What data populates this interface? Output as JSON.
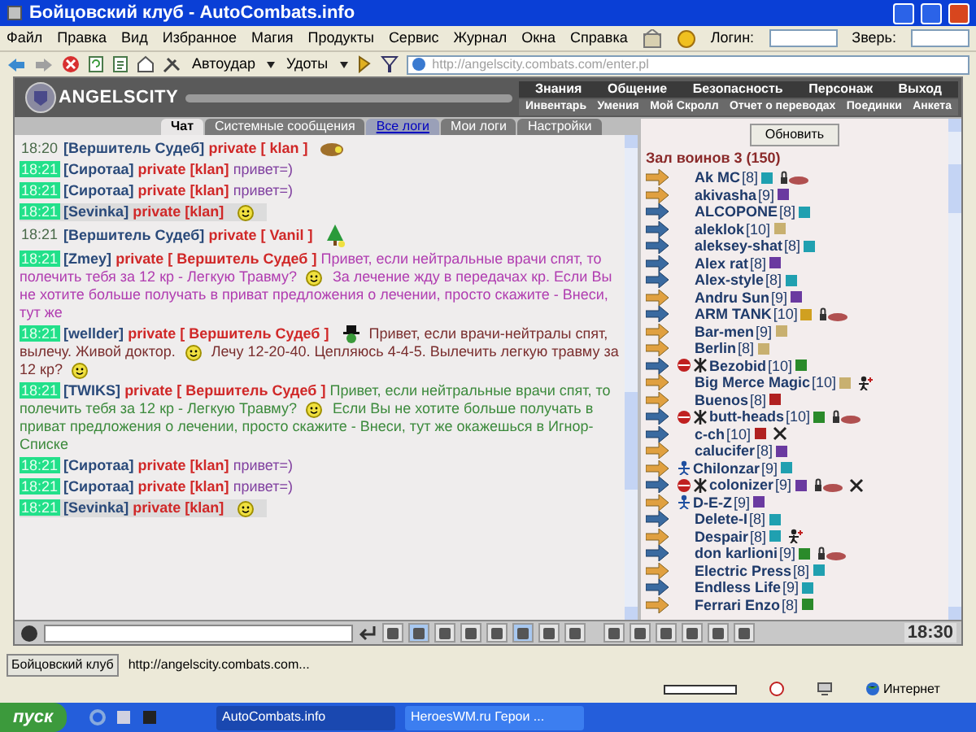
{
  "window": {
    "title": "Бойцовский клуб - AutoCombats.info"
  },
  "menu": [
    "Файл",
    "Правка",
    "Вид",
    "Избранное",
    "Магия",
    "Продукты",
    "Сервис",
    "Журнал",
    "Окна",
    "Справка"
  ],
  "login": {
    "label": "Логин:"
  },
  "pet": {
    "label": "Зверь:"
  },
  "toolbar": {
    "buttons": [
      "Автоудар",
      "Удоты"
    ],
    "address": "http://angelscity.combats.com/enter.pl"
  },
  "game": {
    "logo": "ANGELSCITY",
    "nav_top": [
      "Знания",
      "Общение",
      "Безопасность",
      "Персонаж",
      "Выход"
    ],
    "nav_bottom": [
      "Инвентарь",
      "Умения",
      "Мой Скролл",
      "Отчет о переводах",
      "Поединки",
      "Анкета"
    ]
  },
  "tabs": [
    {
      "label": "Чат",
      "selected": true,
      "kind": "tab"
    },
    {
      "label": "Системные сообщения",
      "selected": false,
      "kind": "tab"
    },
    {
      "label": "Все логи",
      "selected": false,
      "kind": "link"
    },
    {
      "label": "Мои логи",
      "selected": false,
      "kind": "tab"
    },
    {
      "label": "Настройки",
      "selected": false,
      "kind": "tab"
    }
  ],
  "chat": {
    "messages": [
      {
        "time": "18:20",
        "highlighted": false,
        "boxed": false,
        "sender": "[Вершитель Судеб]",
        "target": "private [ klan ]",
        "parts": [
          {
            "kind": "icon"
          }
        ]
      },
      {
        "time": "18:21",
        "highlighted": true,
        "boxed": false,
        "sender": "[Сиротаа]",
        "target": "private [klan]",
        "color": "#8040a0",
        "parts": [
          {
            "kind": "text",
            "text": "привет=)"
          }
        ]
      },
      {
        "time": "18:21",
        "highlighted": true,
        "boxed": false,
        "sender": "[Сиротаа]",
        "target": "private [klan]",
        "color": "#8040a0",
        "parts": [
          {
            "kind": "text",
            "text": "привет=)"
          }
        ]
      },
      {
        "time": "18:21",
        "highlighted": true,
        "boxed": true,
        "sender": "[Sevinka]",
        "target": "private [klan]",
        "parts": [
          {
            "kind": "smiley"
          }
        ]
      },
      {
        "time": "18:21",
        "highlighted": false,
        "boxed": false,
        "sender": "[Вершитель Судеб]",
        "target": "private [ Vanil ]",
        "parts": [
          {
            "kind": "tree"
          }
        ]
      },
      {
        "time": "18:21",
        "highlighted": true,
        "boxed": false,
        "sender": "[Zmey]",
        "target": "private [ Вершитель Судеб ]",
        "color": "#b03cb0",
        "parts": [
          {
            "kind": "text",
            "text": "Привет, если нейтральные врачи спят, то полечить тебя за 12 кр - Легкую Травму?"
          },
          {
            "kind": "smiley"
          },
          {
            "kind": "text",
            "text": "За лечение жду в передачах кр. Если Вы не хотите больше получать в приват предложения о лечении, просто скажите - Внеси, тут же"
          }
        ]
      },
      {
        "time": "18:21",
        "highlighted": true,
        "boxed": false,
        "sender": "[wellder]",
        "target": "private [ Вершитель Судеб ]",
        "color": "#7a2e2e",
        "parts": [
          {
            "kind": "hat"
          },
          {
            "kind": "text",
            "text": "Привет, если врачи-нейтралы спят, вылечу. Живой доктор."
          },
          {
            "kind": "smiley"
          },
          {
            "kind": "text",
            "text": "Лечу 12-20-40. Цепляюсь 4-4-5. Вылечить легкую травму за 12 кр?"
          },
          {
            "kind": "smiley"
          }
        ]
      },
      {
        "time": "18:21",
        "highlighted": true,
        "boxed": false,
        "sender": "[TWIKS]",
        "target": "private [ Вершитель Судеб ]",
        "color": "#3c8a3c",
        "parts": [
          {
            "kind": "text",
            "text": "Привет, если нейтральные врачи спят, то полечить тебя за 12 кр - Легкую Травму?"
          },
          {
            "kind": "smiley"
          },
          {
            "kind": "text",
            "text": "Если Вы не хотите больше получать в приват предложения о лечении, просто скажите - Внеси, тут же окажешься в Игнор-Списке"
          }
        ]
      },
      {
        "time": "18:21",
        "highlighted": true,
        "boxed": false,
        "sender": "[Сиротаа]",
        "target": "private [klan]",
        "color": "#8040a0",
        "parts": [
          {
            "kind": "text",
            "text": "привет=)"
          }
        ]
      },
      {
        "time": "18:21",
        "highlighted": true,
        "boxed": false,
        "sender": "[Сиротаа]",
        "target": "private [klan]",
        "color": "#8040a0",
        "parts": [
          {
            "kind": "text",
            "text": "привет=)"
          }
        ]
      },
      {
        "time": "18:21",
        "highlighted": true,
        "boxed": true,
        "sender": "[Sevinka]",
        "target": "private [klan]",
        "parts": [
          {
            "kind": "smiley"
          }
        ]
      }
    ]
  },
  "room": {
    "refresh_button": "Обновить",
    "title": "Зал воинов 3 (150)",
    "users": [
      {
        "name": "Ak MC",
        "level": "[8]",
        "kind": "light",
        "color": "#20a0b0",
        "locked": true
      },
      {
        "name": "akivasha",
        "level": "[9]",
        "kind": "light",
        "color": "#6a3aa0"
      },
      {
        "name": "ALCOPONE",
        "level": "[8]",
        "kind": "dark",
        "color": "#20a0b0"
      },
      {
        "name": "aleklok",
        "level": "[10]",
        "kind": "dark",
        "color": "#c8b070"
      },
      {
        "name": "aleksey-shat",
        "level": "[8]",
        "kind": "dark",
        "color": "#20a0b0"
      },
      {
        "name": "Alex rat",
        "level": "[8]",
        "kind": "dark",
        "color": "#6a3aa0"
      },
      {
        "name": "Alex-style",
        "level": "[8]",
        "kind": "dark",
        "color": "#20a0b0"
      },
      {
        "name": "Andru Sun",
        "level": "[9]",
        "kind": "light",
        "color": "#6a3aa0"
      },
      {
        "name": "ARM TANK",
        "level": "[10]",
        "kind": "dark",
        "color": "#d0a020",
        "locked": true
      },
      {
        "name": "Bar-men",
        "level": "[9]",
        "kind": "light",
        "color": "#c8b070"
      },
      {
        "name": "Berlin",
        "level": "[8]",
        "kind": "light",
        "color": "#c8b070"
      },
      {
        "name": "Bezobid",
        "level": "[10]",
        "kind": "dark",
        "color": "#2a8a2a",
        "clan": true
      },
      {
        "name": "Big Merce Magic",
        "level": "[10]",
        "kind": "light",
        "color": "#c8b070",
        "healer": true
      },
      {
        "name": "Buenos",
        "level": "[8]",
        "kind": "light",
        "color": "#b02020"
      },
      {
        "name": "butt-heads",
        "level": "[10]",
        "kind": "dark",
        "color": "#2a8a2a",
        "clan": true,
        "locked": true
      },
      {
        "name": "c-ch",
        "level": "[10]",
        "kind": "dark",
        "color": "#b02020",
        "crossed": true
      },
      {
        "name": "calucifer",
        "level": "[8]",
        "kind": "light",
        "color": "#6a3aa0"
      },
      {
        "name": "Chilonzar",
        "level": "[9]",
        "kind": "light",
        "color": "#20a0b0",
        "figure": true
      },
      {
        "name": "colonizer",
        "level": "[9]",
        "kind": "dark",
        "color": "#6a3aa0",
        "clan": true,
        "locked": true,
        "crossed": true
      },
      {
        "name": "D-E-Z",
        "level": "[9]",
        "kind": "light",
        "color": "#6a3aa0",
        "figure": true
      },
      {
        "name": "Delete-I",
        "level": "[8]",
        "kind": "dark",
        "color": "#20a0b0"
      },
      {
        "name": "Despair",
        "level": "[8]",
        "kind": "light",
        "color": "#20a0b0",
        "healer": true
      },
      {
        "name": "don karlioni",
        "level": "[9]",
        "kind": "dark",
        "color": "#2a8a2a",
        "locked": true
      },
      {
        "name": "Electric Press",
        "level": "[8]",
        "kind": "light",
        "color": "#20a0b0"
      },
      {
        "name": "Endless Life",
        "level": "[9]",
        "kind": "dark",
        "color": "#20a0b0"
      },
      {
        "name": "Ferrari Enzo",
        "level": "[8]",
        "kind": "light",
        "color": "#2a8a2a"
      }
    ]
  },
  "bottom_toolbar": {
    "buttons": [
      {
        "pressed": false
      },
      {
        "pressed": true
      },
      {
        "pressed": false
      },
      {
        "pressed": false
      },
      {
        "pressed": false
      },
      {
        "pressed": true
      },
      {
        "pressed": false
      },
      {
        "pressed": false
      },
      {
        "pressed": false
      },
      {
        "pressed": false
      },
      {
        "pressed": false
      },
      {
        "pressed": false
      },
      {
        "pressed": false
      },
      {
        "pressed": false
      }
    ],
    "clock": "18:30"
  },
  "status_bar": {
    "tab": "Бойцовский клуб",
    "url": "http://angelscity.combats.com...",
    "zone": "Интернет"
  },
  "taskbar": {
    "start": "пуск",
    "tasks": [
      {
        "label": "AutoCombats.info",
        "selected": true
      },
      {
        "label": "HeroesWM.ru Герои ...",
        "selected": false
      }
    ]
  }
}
